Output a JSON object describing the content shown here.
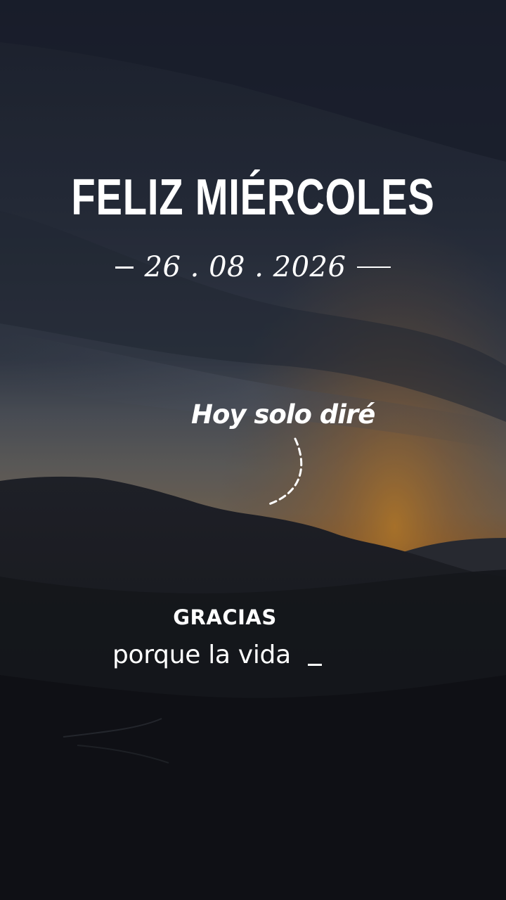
{
  "story": {
    "title": "FELIZ MIÉRCOLES",
    "date": "26 . 08 . 2026",
    "intro": "Hoy solo diré",
    "highlight": "GRACIAS",
    "message": "porque la vida"
  },
  "icons": {
    "arrow": "dashed-curved-arrow-icon",
    "cursor": "text-cursor-underscore"
  },
  "colors": {
    "text": "#ffffff",
    "sky_dark": "#1e2634",
    "sunset": "#c07a2a",
    "mountains": "#15171c"
  }
}
